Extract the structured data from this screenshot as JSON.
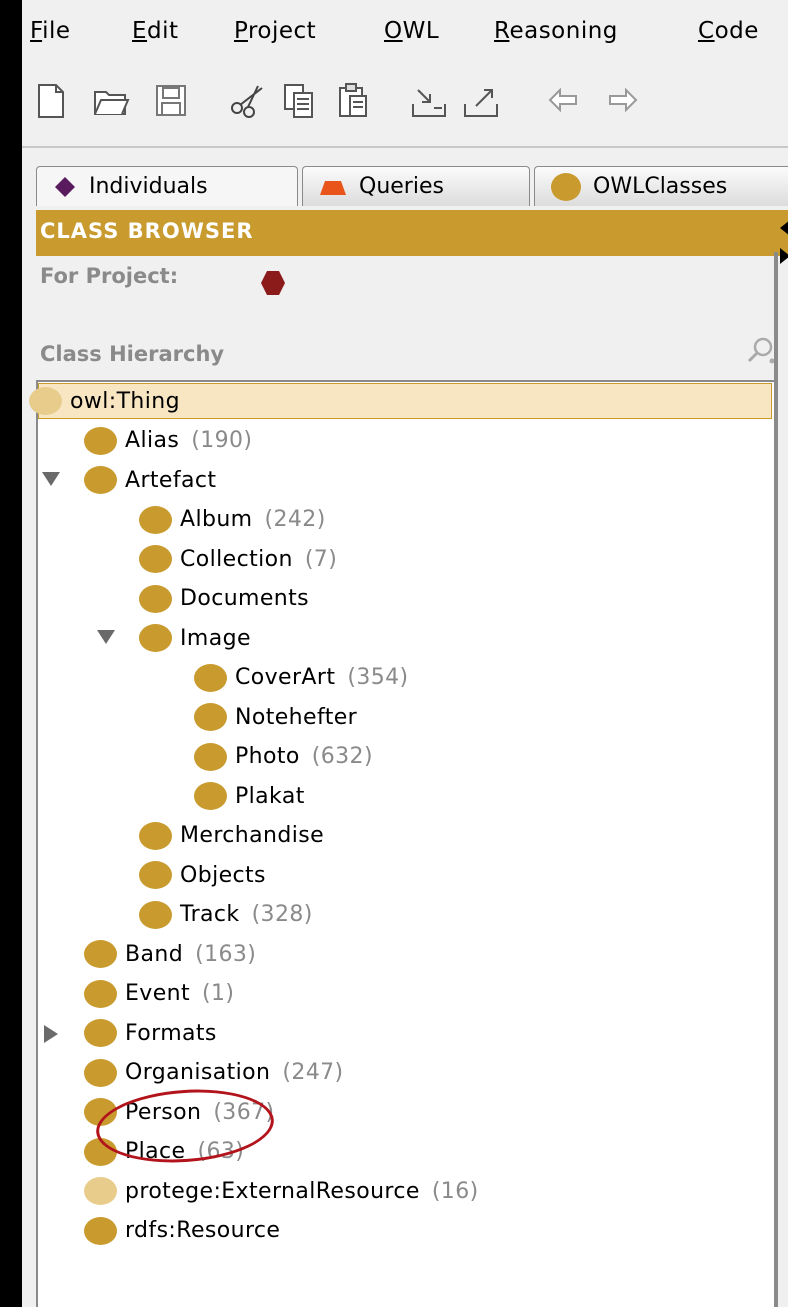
{
  "menu": [
    {
      "mnemonic": "F",
      "rest": "ile"
    },
    {
      "mnemonic": "E",
      "rest": "dit"
    },
    {
      "mnemonic": "P",
      "rest": "roject"
    },
    {
      "mnemonic": "O",
      "rest": "WL"
    },
    {
      "mnemonic": "R",
      "rest": "easoning"
    },
    {
      "mnemonic": "C",
      "rest": "ode"
    }
  ],
  "toolbar": {
    "icons": [
      "new-file-icon",
      "open-folder-icon",
      "save-disk-icon",
      "cut-scissors-icon",
      "copy-icon",
      "paste-icon",
      "import-icon",
      "export-icon",
      "undo-icon",
      "redo-icon"
    ]
  },
  "tabs": [
    {
      "label": "Individuals",
      "icon": "purple-diamond-icon",
      "color": "#5a1a5e"
    },
    {
      "label": "Queries",
      "icon": "orange-triangle-icon",
      "color": "#e8541a"
    },
    {
      "label": "OWLClasses",
      "icon": "gold-circle-icon",
      "color": "#c99a2e"
    }
  ],
  "class_browser": {
    "title": "CLASS BROWSER",
    "for_project": "For Project:",
    "project_icon_color": "#8b1a1a",
    "hierarchy_label": "Class Hierarchy"
  },
  "tree": [
    {
      "label": "owl:Thing",
      "count": "",
      "depth": 0,
      "toggle": "",
      "light": true,
      "selected": true
    },
    {
      "label": "Alias",
      "count": "(190)",
      "depth": 1,
      "toggle": ""
    },
    {
      "label": "Artefact",
      "count": "",
      "depth": 1,
      "toggle": "down"
    },
    {
      "label": "Album",
      "count": "(242)",
      "depth": 2,
      "toggle": ""
    },
    {
      "label": "Collection",
      "count": "(7)",
      "depth": 2,
      "toggle": ""
    },
    {
      "label": "Documents",
      "count": "",
      "depth": 2,
      "toggle": ""
    },
    {
      "label": "Image",
      "count": "",
      "depth": 2,
      "toggle": "down"
    },
    {
      "label": "CoverArt",
      "count": "(354)",
      "depth": 3,
      "toggle": ""
    },
    {
      "label": "Notehefter",
      "count": "",
      "depth": 3,
      "toggle": ""
    },
    {
      "label": "Photo",
      "count": "(632)",
      "depth": 3,
      "toggle": ""
    },
    {
      "label": "Plakat",
      "count": "",
      "depth": 3,
      "toggle": ""
    },
    {
      "label": "Merchandise",
      "count": "",
      "depth": 2,
      "toggle": ""
    },
    {
      "label": "Objects",
      "count": "",
      "depth": 2,
      "toggle": ""
    },
    {
      "label": "Track",
      "count": "(328)",
      "depth": 2,
      "toggle": ""
    },
    {
      "label": "Band",
      "count": "(163)",
      "depth": 1,
      "toggle": ""
    },
    {
      "label": "Event",
      "count": "(1)",
      "depth": 1,
      "toggle": ""
    },
    {
      "label": "Formats",
      "count": "",
      "depth": 1,
      "toggle": "right"
    },
    {
      "label": "Organisation",
      "count": "(247)",
      "depth": 1,
      "toggle": ""
    },
    {
      "label": "Person",
      "count": "(367)",
      "depth": 1,
      "toggle": ""
    },
    {
      "label": "Place",
      "count": "(63)",
      "depth": 1,
      "toggle": ""
    },
    {
      "label": "protege:ExternalResource",
      "count": "(16)",
      "depth": 1,
      "toggle": "",
      "light": true
    },
    {
      "label": "rdfs:Resource",
      "count": "",
      "depth": 1,
      "toggle": ""
    }
  ],
  "colors": {
    "accent": "#c99a2e",
    "annotation": "#b3141c"
  }
}
